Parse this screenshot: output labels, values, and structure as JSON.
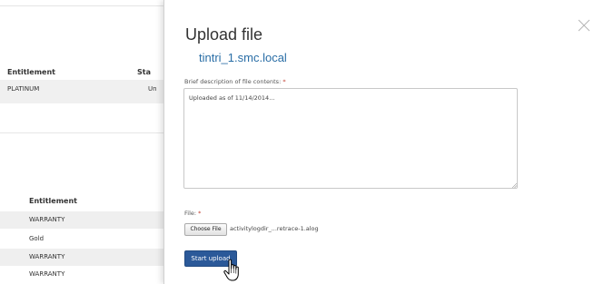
{
  "background_page": {
    "table1": {
      "headers": [
        "Entitlement",
        "Sta"
      ],
      "rows": [
        [
          "PLATINUM",
          "Un"
        ]
      ]
    },
    "table2": {
      "header": "Entitlement",
      "rows": [
        "WARRANTY",
        "Gold",
        "WARRANTY",
        "WARRANTY"
      ]
    }
  },
  "modal": {
    "title": "Upload file",
    "subtitle": "tintri_1.smc.local",
    "description_label": "Brief description of file contents:",
    "required_mark": "*",
    "description_value": "Uploaded as of 11/14/2014...",
    "file_label": "File:",
    "choose_file_label": "Choose File",
    "file_name": "activitylogdir_...retrace-1.alog",
    "start_upload_label": "Start upload"
  },
  "colors": {
    "primary_button": "#2b5999",
    "subtitle": "#2a6ea6",
    "required": "#c0392b"
  },
  "icons": {
    "close": "close-icon",
    "cursor": "hand-cursor-icon"
  }
}
